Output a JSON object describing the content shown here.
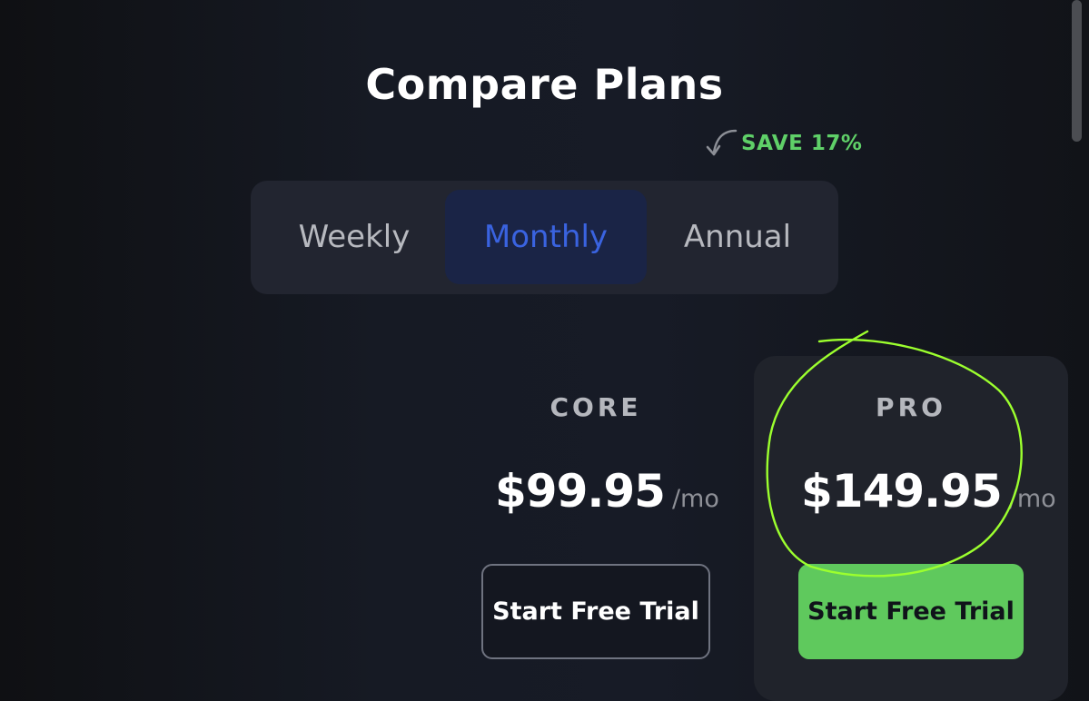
{
  "page": {
    "title": "Compare Plans"
  },
  "billing": {
    "save_badge": "SAVE 17%",
    "options": [
      {
        "label": "Weekly",
        "selected": false
      },
      {
        "label": "Monthly",
        "selected": true
      },
      {
        "label": "Annual",
        "selected": false
      }
    ]
  },
  "plans": [
    {
      "name": "CORE",
      "price": "$99.95",
      "period": "/mo",
      "cta": "Start Free Trial"
    },
    {
      "name": "PRO",
      "price": "$149.95",
      "period": "/mo",
      "cta": "Start Free Trial"
    }
  ],
  "colors": {
    "background": "#161a24",
    "accent_blue": "#3a63e0",
    "save_green": "#5fd068",
    "cta_green": "#5fc95d",
    "annotation_green": "#9cff2e"
  },
  "icons": {
    "save_arrow": "curved-arrow-icon"
  }
}
